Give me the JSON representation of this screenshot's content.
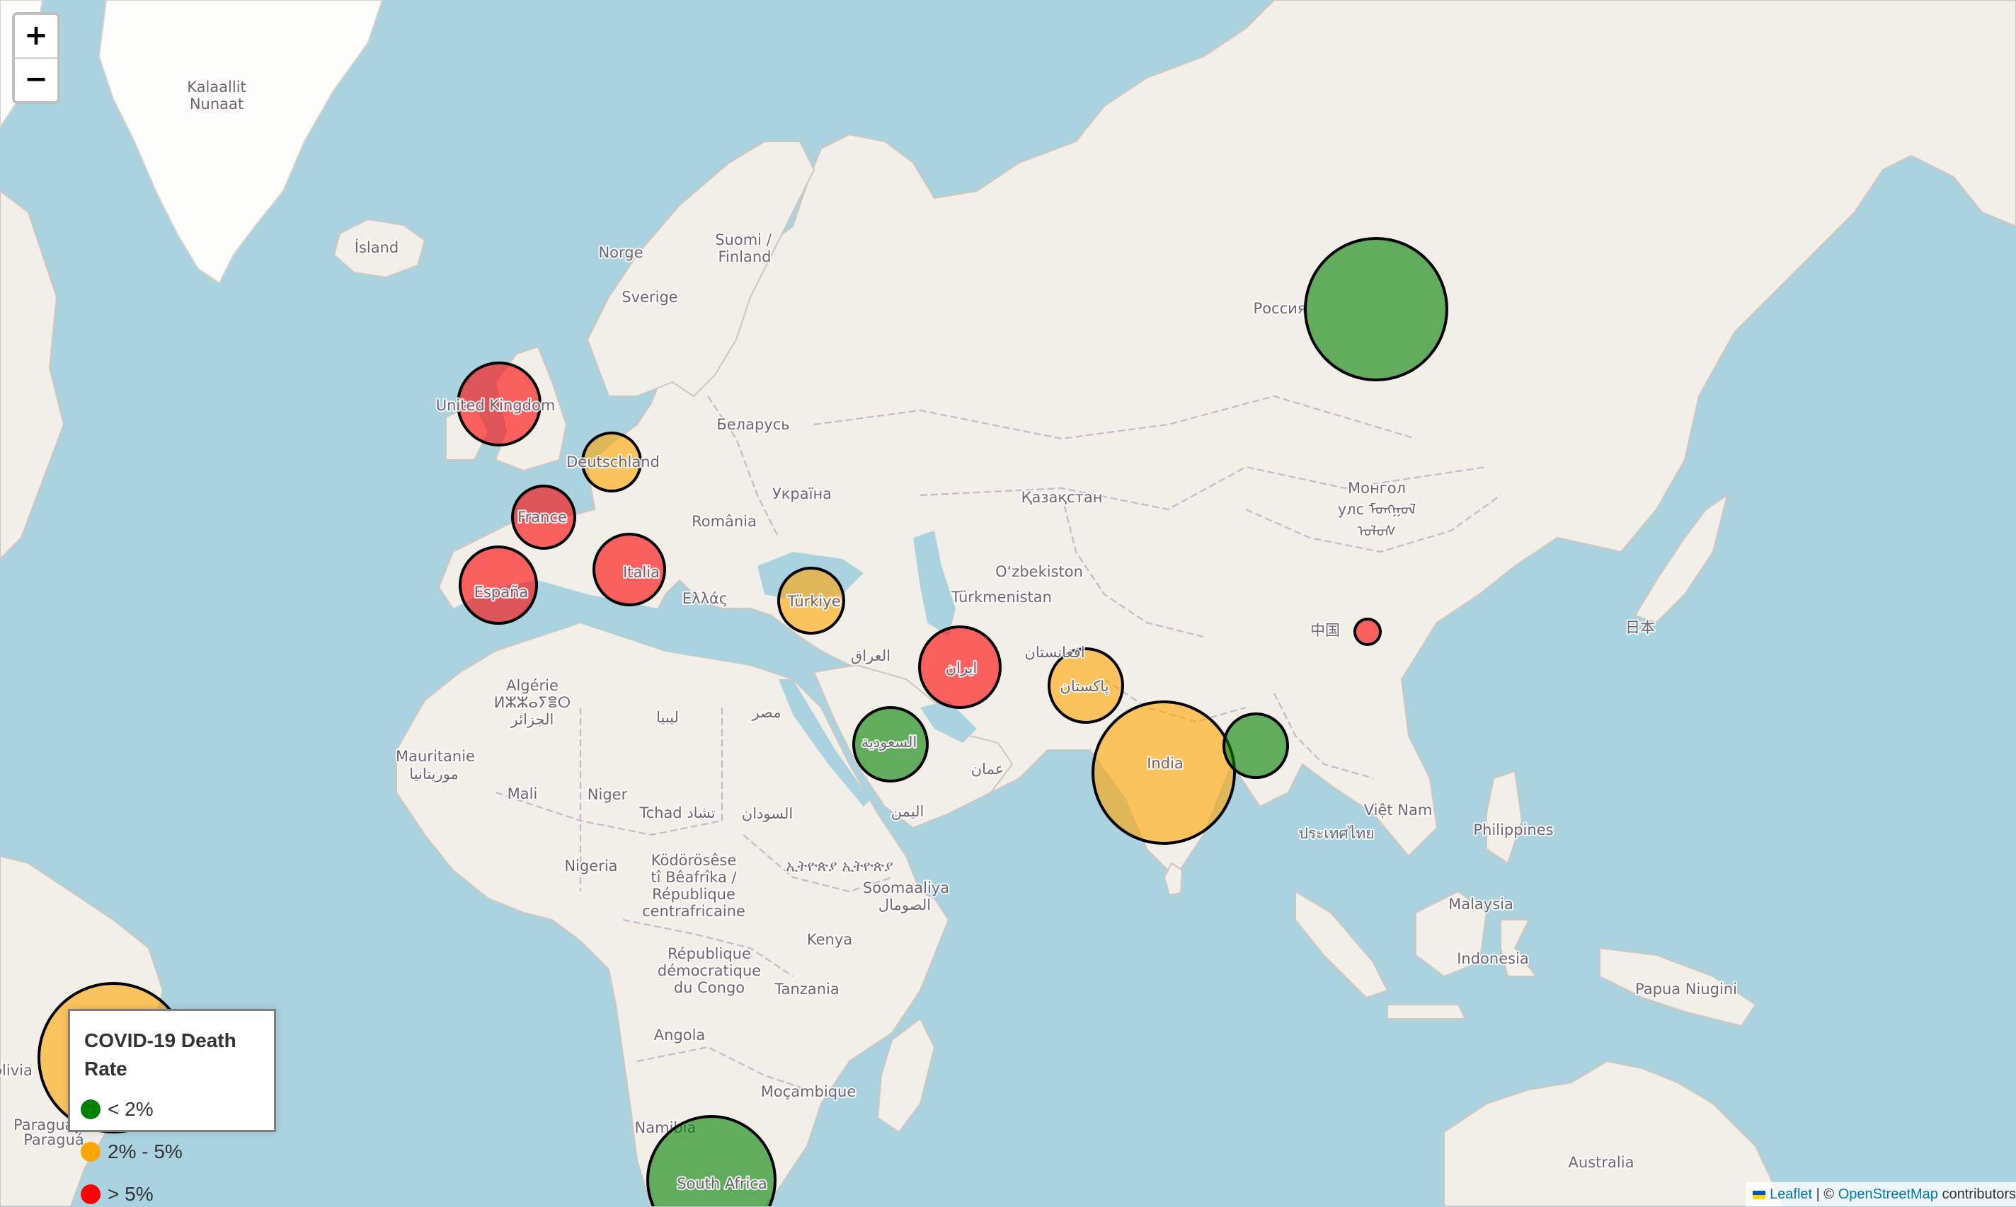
{
  "zoom_control": {
    "zoom_in_label": "+",
    "zoom_out_label": "−"
  },
  "place_labels": [
    {
      "id": "greenland",
      "text": "Kalaallit"
    },
    {
      "id": "greenland2",
      "text": "Nunaat"
    },
    {
      "id": "iceland",
      "text": "Ísland"
    },
    {
      "id": "norway",
      "text": "Norge"
    },
    {
      "id": "sweden",
      "text": "Sverige"
    },
    {
      "id": "finland",
      "text": "Suomi /"
    },
    {
      "id": "finland2",
      "text": "Finland"
    },
    {
      "id": "belarus",
      "text": "Беларусь"
    },
    {
      "id": "ukraine",
      "text": "Україна"
    },
    {
      "id": "romania",
      "text": "România"
    },
    {
      "id": "greece",
      "text": "Ελλάς"
    },
    {
      "id": "kazakhstan",
      "text": "Қазақстан"
    },
    {
      "id": "russia",
      "text": "Россия"
    },
    {
      "id": "mongolia",
      "text": "Монгол"
    },
    {
      "id": "mongolia2",
      "text": "улс ᠮᠤᠩᠭᠤᠯ"
    },
    {
      "id": "mongolia3",
      "text": "ᠤᠯᠤᠰ"
    },
    {
      "id": "uzbekistan",
      "text": "O‘zbekiston"
    },
    {
      "id": "turkmenistan",
      "text": "Türkmenistan"
    },
    {
      "id": "iraq",
      "text": "العراق"
    },
    {
      "id": "china",
      "text": "中国"
    },
    {
      "id": "japan",
      "text": "日本"
    },
    {
      "id": "algeria",
      "text": "Algérie"
    },
    {
      "id": "algeria2",
      "text": "ⵍⵣⵣⴰⵢⴻⵔ"
    },
    {
      "id": "algeria3",
      "text": "الجزائر"
    },
    {
      "id": "libya",
      "text": "ليبيا"
    },
    {
      "id": "egypt",
      "text": "مصر"
    },
    {
      "id": "mauritania",
      "text": "Mauritanie"
    },
    {
      "id": "mauritania2",
      "text": "موريتانيا"
    },
    {
      "id": "mali",
      "text": "Mali"
    },
    {
      "id": "niger",
      "text": "Niger"
    },
    {
      "id": "chad",
      "text": "Tchad تشاد"
    },
    {
      "id": "sudan",
      "text": "السودان"
    },
    {
      "id": "yemen",
      "text": "اليمن"
    },
    {
      "id": "oman",
      "text": "عمان"
    },
    {
      "id": "nigeria",
      "text": "Nigeria"
    },
    {
      "id": "car",
      "text": "Ködörösêse"
    },
    {
      "id": "car2",
      "text": "tî Bêafrîka /"
    },
    {
      "id": "car3",
      "text": "République"
    },
    {
      "id": "car4",
      "text": "centrafricaine"
    },
    {
      "id": "ethiopia",
      "text": "ኢትዮጵያ ኢትዮጵያ"
    },
    {
      "id": "somalia",
      "text": "Soomaaliya"
    },
    {
      "id": "somalia2",
      "text": "الصومال"
    },
    {
      "id": "kenya",
      "text": "Kenya"
    },
    {
      "id": "drc",
      "text": "République"
    },
    {
      "id": "drc2",
      "text": "démocratique"
    },
    {
      "id": "drc3",
      "text": "du Congo"
    },
    {
      "id": "tanzania",
      "text": "Tanzania"
    },
    {
      "id": "angola",
      "text": "Angola"
    },
    {
      "id": "mozambique",
      "text": "Moçambique"
    },
    {
      "id": "namibia",
      "text": "Namibia"
    },
    {
      "id": "vietnam",
      "text": "Việt Nam"
    },
    {
      "id": "thailand",
      "text": "ประเทศไทย"
    },
    {
      "id": "philippines",
      "text": "Philippines"
    },
    {
      "id": "malaysia",
      "text": "Malaysia"
    },
    {
      "id": "indonesia",
      "text": "Indonesia"
    },
    {
      "id": "png",
      "text": "Papua Niugini"
    },
    {
      "id": "australia",
      "text": "Australia"
    },
    {
      "id": "bolivia",
      "text": "olivia"
    },
    {
      "id": "paraguay",
      "text": "Paraguá"
    },
    {
      "id": "paraguay2",
      "text": "Paraguay"
    }
  ],
  "markers": [
    {
      "country": "United Kingdom",
      "label": "United Kingdom",
      "color": "#ff0000",
      "rate_band": "> 5%"
    },
    {
      "country": "Germany",
      "label": "Deutschland",
      "color": "#ffa500",
      "rate_band": "2% - 5%"
    },
    {
      "country": "France",
      "label": "France",
      "color": "#ff0000",
      "rate_band": "> 5%"
    },
    {
      "country": "Spain",
      "label": "España",
      "color": "#ff0000",
      "rate_band": "> 5%"
    },
    {
      "country": "Italy",
      "label": "Italia",
      "color": "#ff0000",
      "rate_band": "> 5%"
    },
    {
      "country": "Turkey",
      "label": "Türkiye",
      "color": "#ffa500",
      "rate_band": "2% - 5%"
    },
    {
      "country": "Iran",
      "label": "ایران",
      "color": "#ff0000",
      "rate_band": "> 5%"
    },
    {
      "country": "Saudi Arabia",
      "label": "السعودية",
      "color": "#008000",
      "rate_band": "< 2%"
    },
    {
      "country": "Pakistan",
      "label": "پاکستان",
      "color": "#ffa500",
      "rate_band": "2% - 5%"
    },
    {
      "country": "India",
      "label": "India",
      "color": "#ffa500",
      "rate_band": "2% - 5%"
    },
    {
      "country": "Bangladesh",
      "label": "",
      "color": "#008000",
      "rate_band": "< 2%"
    },
    {
      "country": "Russia",
      "label": "",
      "color": "#008000",
      "rate_band": "< 2%"
    },
    {
      "country": "China",
      "label": "",
      "color": "#ff0000",
      "rate_band": "> 5%"
    },
    {
      "country": "South Africa",
      "label": "South Africa",
      "color": "#008000",
      "rate_band": "< 2%"
    },
    {
      "country": "Brazil",
      "label": "",
      "color": "#ffa500",
      "rate_band": "2% - 5%"
    },
    {
      "country": "Afghanistan",
      "label": "افغانستان",
      "color": "",
      "rate_band": ""
    }
  ],
  "legend": {
    "title_line1": "COVID-19 Death",
    "title_line2": "Rate",
    "items": [
      {
        "label": "< 2%",
        "color": "#008000"
      },
      {
        "label": "2% - 5%",
        "color": "#ffa500"
      },
      {
        "label": "> 5%",
        "color": "#ff0000"
      }
    ]
  },
  "attribution": {
    "leaflet": "Leaflet",
    "separator": " | © ",
    "osm": "OpenStreetMap",
    "suffix": " contributors"
  }
}
